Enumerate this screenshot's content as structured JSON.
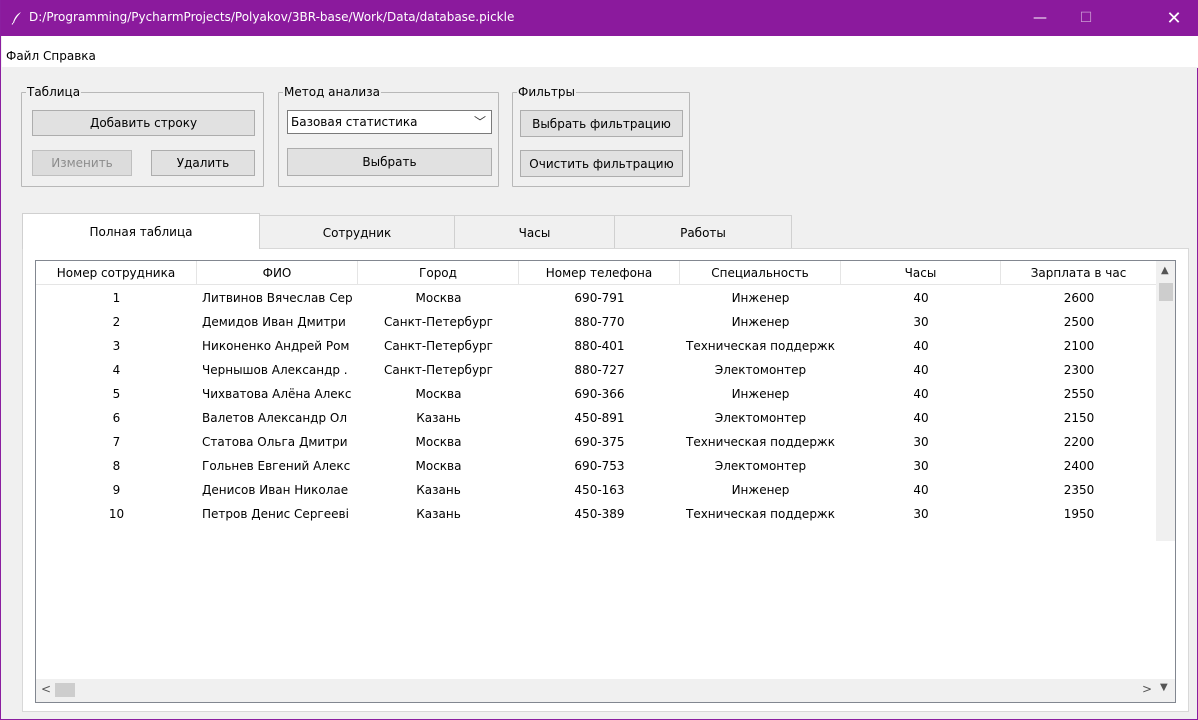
{
  "window": {
    "title": "D:/Programming/PycharmProjects/Polyakov/3BR-base/Work/Data/database.pickle",
    "minimize_glyph": "—",
    "maximize_glyph": "☐",
    "close_glyph": "✕",
    "accent_color": "#8b1a9d"
  },
  "menu": {
    "file": "Файл",
    "help": "Справка"
  },
  "table_group": {
    "label": "Таблица",
    "add_row": "Добавить строку",
    "edit": "Изменить",
    "delete": "Удалить"
  },
  "analysis_group": {
    "label": "Метод анализа",
    "selected_method": "Базовая статистика",
    "select_button": "Выбрать"
  },
  "filters_group": {
    "label": "Фильтры",
    "choose_filter": "Выбрать фильтрацию",
    "clear_filter": "Очистить фильтрацию"
  },
  "tabs": [
    {
      "label": "Полная таблица"
    },
    {
      "label": "Сотрудник"
    },
    {
      "label": "Часы"
    },
    {
      "label": "Работы"
    }
  ],
  "table": {
    "columns": [
      "Номер сотрудника",
      "ФИО",
      "Город",
      "Номер телефона",
      "Специальность",
      "Часы",
      "Зарплата в час"
    ],
    "rows": [
      [
        "1",
        "Литвинов Вячеслав Сер",
        "Москва",
        "690-791",
        "Инженер",
        "40",
        "2600"
      ],
      [
        "2",
        "Демидов Иван Дмитри",
        "Санкт-Петербург",
        "880-770",
        "Инженер",
        "30",
        "2500"
      ],
      [
        "3",
        "Никоненко Андрей Ром",
        "Санкт-Петербург",
        "880-401",
        "Техническая поддержк",
        "40",
        "2100"
      ],
      [
        "4",
        "Чернышов Александр .",
        "Санкт-Петербург",
        "880-727",
        "Электомонтер",
        "40",
        "2300"
      ],
      [
        "5",
        "Чихватова Алёна Алекс",
        "Москва",
        "690-366",
        "Инженер",
        "40",
        "2550"
      ],
      [
        "6",
        "Валетов Александр Ол",
        "Казань",
        "450-891",
        "Электомонтер",
        "40",
        "2150"
      ],
      [
        "7",
        "Статова Ольга Дмитри",
        "Москва",
        "690-375",
        "Техническая поддержк",
        "30",
        "2200"
      ],
      [
        "8",
        "Гольнев Евгений Алекс",
        "Москва",
        "690-753",
        "Электомонтер",
        "30",
        "2400"
      ],
      [
        "9",
        "Денисов Иван Николае",
        "Казань",
        "450-163",
        "Инженер",
        "40",
        "2350"
      ],
      [
        "10",
        "Петров Денис Сергееві",
        "Казань",
        "450-389",
        "Техническая поддержк",
        "30",
        "1950"
      ]
    ]
  }
}
